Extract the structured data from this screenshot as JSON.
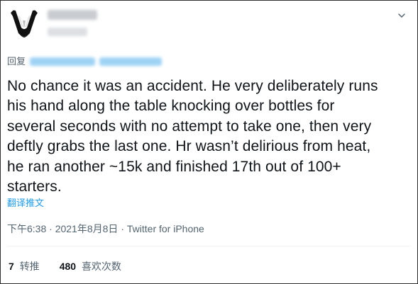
{
  "tweet": {
    "reply_prefix": "回复",
    "text": "No chance it was an accident. He very deliberately runs\nhis hand along the table knocking over bottles for\nseveral seconds with no attempt to take one, then very\ndeftly grabs the last one. Hr wasn’t delirious from heat,\nhe ran another ~15k and finished 17th out of 100+\nstarters.",
    "translate_label": "翻译推文",
    "time": "下午6:38",
    "separator": "·",
    "date": "2021年8月8日",
    "source": "Twitter for iPhone",
    "stats": [
      {
        "value": "7",
        "label": "转推"
      },
      {
        "value": "480",
        "label": "喜欢次数"
      }
    ]
  },
  "colors": {
    "text": "#0f1419",
    "secondary": "#536471",
    "link": "#1d9bf0",
    "divider": "#eff3f4"
  },
  "icons": {
    "more": "more-options-icon",
    "avatar": "avatar-image"
  }
}
